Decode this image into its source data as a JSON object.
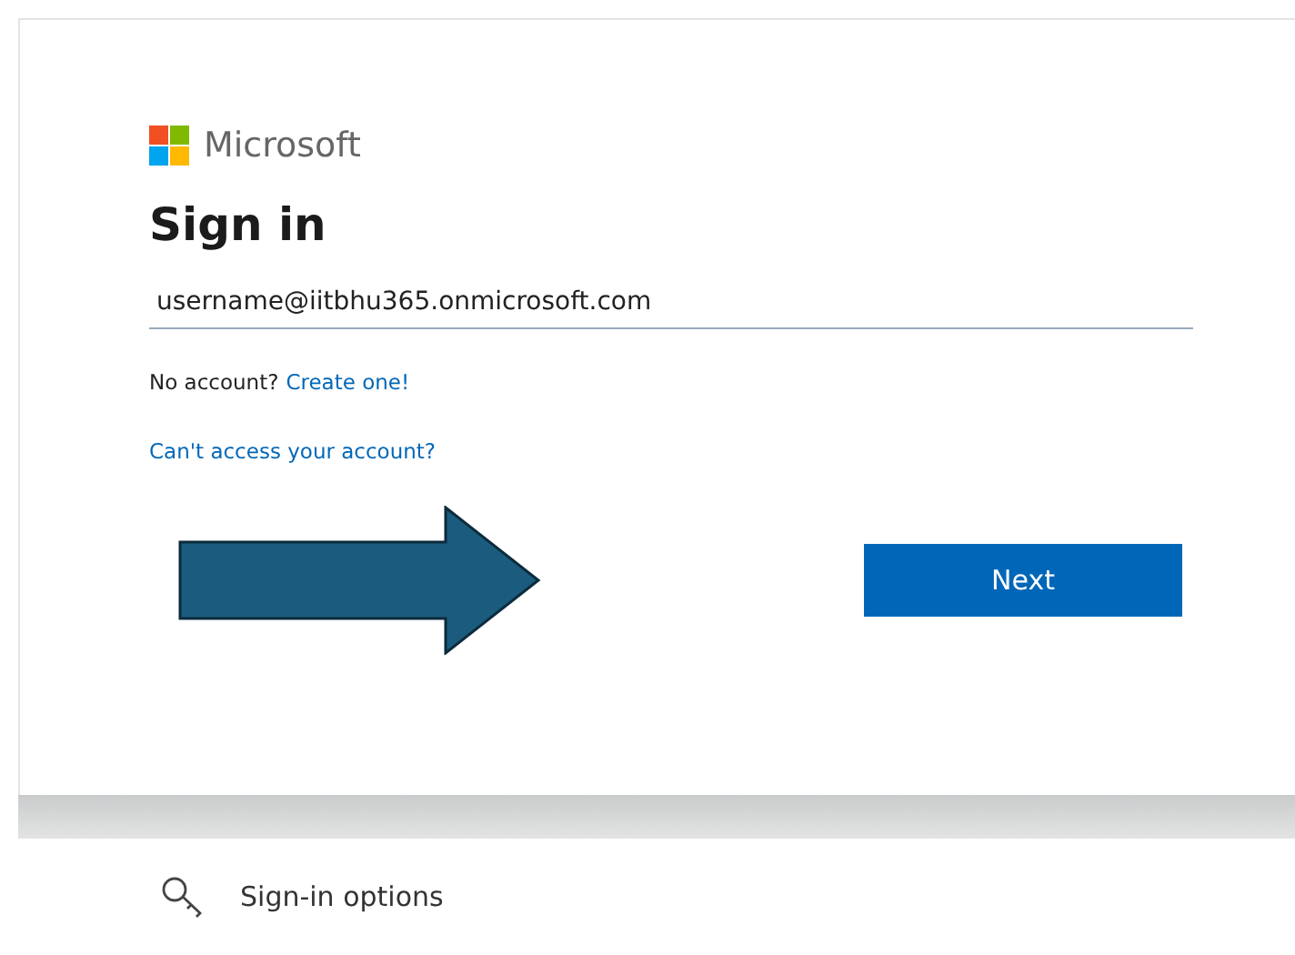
{
  "brand": {
    "name": "Microsoft"
  },
  "heading": "Sign in",
  "email_field": {
    "value": "username@iitbhu365.onmicrosoft.com"
  },
  "no_account": {
    "text": "No account?",
    "link": "Create one!"
  },
  "cant_access_link": "Can't access your account?",
  "next_button": "Next",
  "sign_in_options": "Sign-in options"
}
